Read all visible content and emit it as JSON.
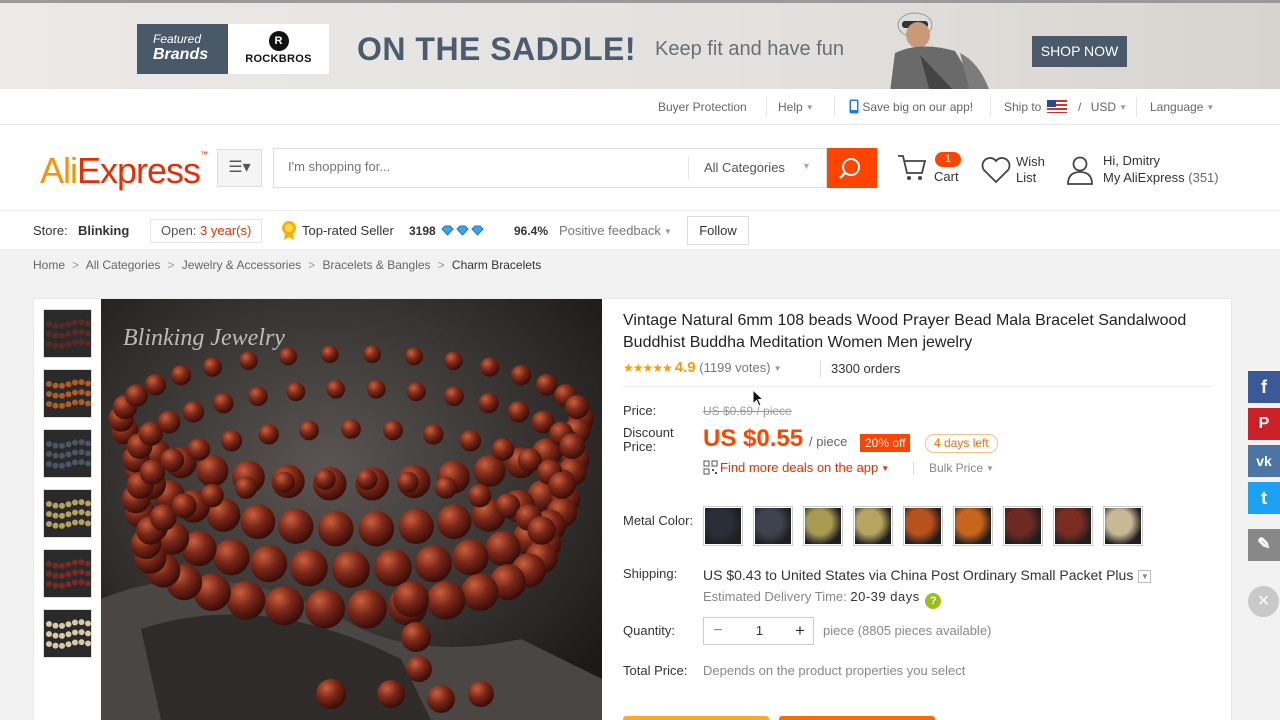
{
  "banner": {
    "featured_l1": "Featured",
    "featured_l2": "Brands",
    "brand_name": "ROCKBROS",
    "headline": "ON THE SADDLE!",
    "tagline": "Keep fit and have fun",
    "shop_now": "SHOP NOW"
  },
  "utility": {
    "buyer_protection": "Buyer Protection",
    "help": "Help",
    "app": "Save big on our app!",
    "ship_to": "Ship to",
    "currency_sep": "/",
    "currency": "USD",
    "language": "Language"
  },
  "header": {
    "logo_ali": "Ali",
    "logo_express": "Express",
    "search_placeholder": "I'm shopping for...",
    "all_categories": "All Categories",
    "cart_count": "1",
    "cart_label": "Cart",
    "wish_l1": "Wish",
    "wish_l2": "List",
    "greeting": "Hi, Dmitry",
    "my_ali": "My AliExpress",
    "my_ali_count": "(351)"
  },
  "store": {
    "label": "Store:",
    "name": "Blinking",
    "open_label": "Open:",
    "open_years": "3 year(s)",
    "top_rated": "Top-rated Seller",
    "score": "3198",
    "positive_pct": "96.4%",
    "positive_label": "Positive feedback",
    "follow": "Follow"
  },
  "breadcrumb": [
    "Home",
    "All Categories",
    "Jewelry & Accessories",
    "Bracelets & Bangles",
    "Charm Bracelets"
  ],
  "product": {
    "title": "Vintage Natural 6mm 108 beads Wood Prayer Bead Mala Bracelet Sandalwood Buddhist Buddha Meditation Women Men jewelry",
    "stars": "★★★★★",
    "rating": "4.9",
    "votes": "(1199 votes)",
    "orders": "3300 orders",
    "watermark": "Blinking Jewelry",
    "price_label": "Price:",
    "old_price": "US $0.69 / piece",
    "discount_label_l1": "Discount",
    "discount_label_l2": "Price:",
    "new_price": "US $0.55",
    "per": "/ piece",
    "off": "20% off",
    "days_left": "4 days left",
    "deals": "Find more deals on the app",
    "bulk": "Bulk Price",
    "color_label": "Metal Color:",
    "shipping_label": "Shipping:",
    "shipping_text": "US $0.43 to United States via China Post Ordinary Small Packet Plus",
    "est_label": "Estimated Delivery Time:",
    "est_days": "20-39 days",
    "qty_label": "Quantity:",
    "qty_minus": "−",
    "qty_value": "1",
    "qty_plus": "+",
    "qty_info": "piece (8805 pieces available)",
    "total_label": "Total Price:",
    "total_value": "Depends on the product properties you select"
  },
  "colors": {
    "swatches": [
      "#2a2e38",
      "#3d4450",
      "#a89a55",
      "#b5a462",
      "#b5521e",
      "#c7651f",
      "#6e2a22",
      "#7a2c20",
      "#c9b896"
    ],
    "thumb_colors": [
      "#5a2a22",
      "#b35a22",
      "#4a5566",
      "#b3a160",
      "#7a2a22",
      "#d8c9a8"
    ]
  },
  "social": {
    "facebook": "f",
    "pinterest": "P",
    "vk": "vk",
    "twitter": "t",
    "edit": "✎",
    "close": "×"
  }
}
